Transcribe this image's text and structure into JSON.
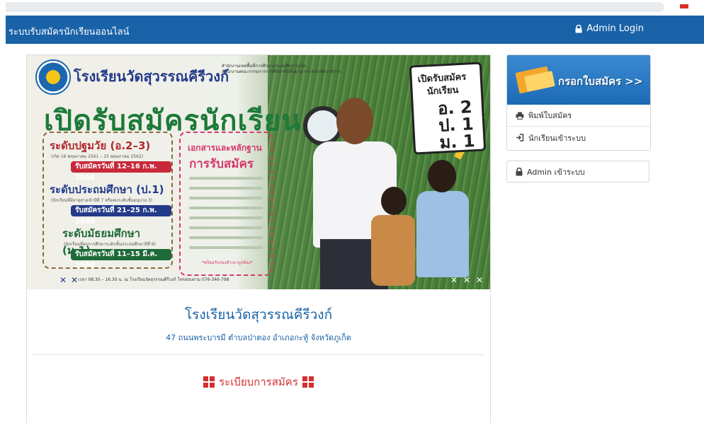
{
  "navbar": {
    "brand": "ระบบรับสมัครนักเรียนออนไลน์",
    "admin_login": "Admin Login",
    "color": "#1a62a8"
  },
  "banner": {
    "school_name": "โรงเรียนวัดสุวรรณคีรีวงก์",
    "agency_lines": [
      "สำนักงานเขตพื้นที่การศึกษาประถมศึกษาภูเก็ต",
      "สำนักงานคณะกรรมการการศึกษาขั้นพื้นฐาน กระทรวงศึกษาธิการ"
    ],
    "headline": "เปิดรับสมัครนักเรียน",
    "levels": [
      {
        "title": "ระดับปฐมวัย (อ.2–3)",
        "note": "(เกิด 16 พฤษภาคม 2561 – 15 พฤษภาคม 2562)",
        "dates": "รับสมัครวันที่ 12–16 ก.พ. 2566"
      },
      {
        "title": "ระดับประถมศึกษา (ป.1)",
        "note": "(นักเรียนที่มีอายุย่างเข้าปีที่ 7 หรือจบระดับชั้นอนุบาล 3)",
        "dates": "รับสมัครวันที่ 21–25 ก.พ. 2566"
      },
      {
        "title": "ระดับมัธยมศึกษา (ม.1)",
        "note": "(นักเรียนที่จบการศึกษาระดับชั้นประถมศึกษาปีที่ 6)",
        "dates": "รับสมัครวันที่ 11–15 มี.ค. 2566"
      }
    ],
    "docs_title_1": "เอกสารและหลักฐาน",
    "docs_title_2": "การรับสมัคร",
    "docs_note": "*พร้อมรับรองสำเนาถูกต้อง*",
    "sign_line_1": "เปิดรับสมัคร",
    "sign_line_2": "นักเรียน",
    "sign_grades": [
      "อ. 2",
      "ป. 1",
      "ม. 1"
    ],
    "footer": "เวลา 08.30 – 16.30 น. ณ โรงเรียนวัดสุวรรณคีรีวงก์ โทรสอบถาม 076-346-798"
  },
  "school": {
    "name": "โรงเรียนวัดสุวรรณคีรีวงก์",
    "address": "47 ถนนพระบารมี ตำบลป่าตอง อำเภอกะทู้ จังหวัดภูเก็ต"
  },
  "rules_title": "ระเบียบการสมัคร",
  "sidebar": {
    "apply_button": "กรอกใบสมัคร >>",
    "print_link": "พิมพ์ใบสมัคร",
    "student_login": "นักเรียนเข้าระบบ",
    "admin_login": "Admin เข้าระบบ"
  },
  "icons": {
    "lock": "lock-icon",
    "print": "print-icon",
    "sign_in": "sign-in-icon",
    "grid": "th-large-icon"
  },
  "colors": {
    "primary": "#1a62a8",
    "accent_red": "#d32f2f"
  }
}
